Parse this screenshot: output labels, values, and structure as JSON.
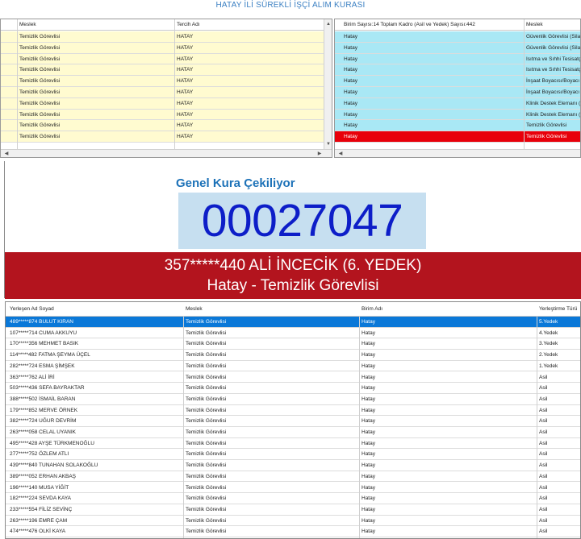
{
  "title": "HATAY İLİ SÜREKLİ İŞÇİ ALIM KURASI",
  "left_grid": {
    "columns": [
      "Meslek",
      "Tercih Adı"
    ],
    "rows": [
      {
        "meslek": "Temizlik Görevlisi",
        "tercih": "HATAY"
      },
      {
        "meslek": "Temizlik Görevlisi",
        "tercih": "HATAY"
      },
      {
        "meslek": "Temizlik Görevlisi",
        "tercih": "HATAY"
      },
      {
        "meslek": "Temizlik Görevlisi",
        "tercih": "HATAY"
      },
      {
        "meslek": "Temizlik Görevlisi",
        "tercih": "HATAY"
      },
      {
        "meslek": "Temizlik Görevlisi",
        "tercih": "HATAY"
      },
      {
        "meslek": "Temizlik Görevlisi",
        "tercih": "HATAY"
      },
      {
        "meslek": "Temizlik Görevlisi",
        "tercih": "HATAY"
      },
      {
        "meslek": "Temizlik Görevlisi",
        "tercih": "HATAY"
      },
      {
        "meslek": "Temizlik Görevlisi",
        "tercih": "HATAY"
      }
    ]
  },
  "right_grid": {
    "columns": [
      "Birim Sayısı:14 Toplam Kadro (Asil ve Yedek) Sayısı:442",
      "Meslek"
    ],
    "rows": [
      {
        "birim": "Hatay",
        "meslek": "Güvenlik Görevlisi (Silah"
      },
      {
        "birim": "Hatay",
        "meslek": "Güvenlik Görevlisi (Silah"
      },
      {
        "birim": "Hatay",
        "meslek": "Isıtma ve Sıhhi Tesisatçı"
      },
      {
        "birim": "Hatay",
        "meslek": "Isıtma ve Sıhhi Tesisatçı"
      },
      {
        "birim": "Hatay",
        "meslek": "İnşaat Boyacısı/Boyacı"
      },
      {
        "birim": "Hatay",
        "meslek": "İnşaat Boyacısı/Boyacı"
      },
      {
        "birim": "Hatay",
        "meslek": "Klinik Destek Elemanı (H"
      },
      {
        "birim": "Hatay",
        "meslek": "Klinik Destek Elemanı (H"
      },
      {
        "birim": "Hatay",
        "meslek": "Temizlik Görevlisi"
      },
      {
        "birim": "Hatay",
        "meslek": "Temizlik Görevlisi"
      }
    ],
    "selected_index": 9
  },
  "draw": {
    "heading": "Genel Kura Çekiliyor",
    "number": "00027047",
    "result_line1": "357*****440 ALİ İNCECİK (6. YEDEK)",
    "result_line2": "Hatay - Temizlik Görevlisi"
  },
  "bottom_grid": {
    "columns": [
      "Yerleşen Ad Soyad",
      "Meslek",
      "Birim Adı",
      "Yerleştirme Türü"
    ],
    "selected_index": 0,
    "rows": [
      {
        "name": "489*****874 BULUT KIRAN",
        "meslek": "Temizlik Görevlisi",
        "birim": "Hatay",
        "tur": "5.Yedek"
      },
      {
        "name": "107*****714 CUMA AKKUYU",
        "meslek": "Temizlik Görevlisi",
        "birim": "Hatay",
        "tur": "4.Yedek"
      },
      {
        "name": "170*****356 MEHMET BASIK",
        "meslek": "Temizlik Görevlisi",
        "birim": "Hatay",
        "tur": "3.Yedek"
      },
      {
        "name": "114*****482 FATMA ŞEYMA ÜÇEL",
        "meslek": "Temizlik Görevlisi",
        "birim": "Hatay",
        "tur": "2.Yedek"
      },
      {
        "name": "282*****724 ESMA ŞİMŞEK",
        "meslek": "Temizlik Görevlisi",
        "birim": "Hatay",
        "tur": "1.Yedek"
      },
      {
        "name": "363*****762 ALİ İRİ",
        "meslek": "Temizlik Görevlisi",
        "birim": "Hatay",
        "tur": "Asil"
      },
      {
        "name": "503*****436 SEFA BAYRAKTAR",
        "meslek": "Temizlik Görevlisi",
        "birim": "Hatay",
        "tur": "Asil"
      },
      {
        "name": "388*****502 İSMAİL BARAN",
        "meslek": "Temizlik Görevlisi",
        "birim": "Hatay",
        "tur": "Asil"
      },
      {
        "name": "179*****852 MERVE ÖRNEK",
        "meslek": "Temizlik Görevlisi",
        "birim": "Hatay",
        "tur": "Asil"
      },
      {
        "name": "382*****724 UĞUR DEVRİM",
        "meslek": "Temizlik Görevlisi",
        "birim": "Hatay",
        "tur": "Asil"
      },
      {
        "name": "263*****058 CELAL UYANIK",
        "meslek": "Temizlik Görevlisi",
        "birim": "Hatay",
        "tur": "Asil"
      },
      {
        "name": "495*****428 AYŞE TÜRKMENOĞLU",
        "meslek": "Temizlik Görevlisi",
        "birim": "Hatay",
        "tur": "Asil"
      },
      {
        "name": "277*****752 ÖZLEM ATLI",
        "meslek": "Temizlik Görevlisi",
        "birim": "Hatay",
        "tur": "Asil"
      },
      {
        "name": "439*****840 TUNAHAN SOLAKOĞLU",
        "meslek": "Temizlik Görevlisi",
        "birim": "Hatay",
        "tur": "Asil"
      },
      {
        "name": "389*****052 ERHAN AKBAŞ",
        "meslek": "Temizlik Görevlisi",
        "birim": "Hatay",
        "tur": "Asil"
      },
      {
        "name": "196*****140 MUSA YİĞİT",
        "meslek": "Temizlik Görevlisi",
        "birim": "Hatay",
        "tur": "Asil"
      },
      {
        "name": "182*****224 SEVDA KAYA",
        "meslek": "Temizlik Görevlisi",
        "birim": "Hatay",
        "tur": "Asil"
      },
      {
        "name": "233*****554 FİLİZ SEVİNÇ",
        "meslek": "Temizlik Görevlisi",
        "birim": "Hatay",
        "tur": "Asil"
      },
      {
        "name": "263*****196 EMRE ÇAM",
        "meslek": "Temizlik Görevlisi",
        "birim": "Hatay",
        "tur": "Asil"
      },
      {
        "name": "474*****476 OLKİ KAYA",
        "meslek": "Temizlik Görevlisi",
        "birim": "Hatay",
        "tur": "Asil"
      }
    ]
  },
  "colors": {
    "title": "#3a7fc2",
    "left_row_bg": "#fffbd0",
    "right_row_bg": "#a9e8f5",
    "right_selected_bg": "#e8000a",
    "banner_bg": "#b3141e",
    "number_color": "#0d1ec8",
    "number_box_bg": "#c6dff0",
    "bottom_selected_bg": "#0a78d8"
  },
  "icons": [
    "chevron-up-icon",
    "chevron-down-icon",
    "chevron-left-icon",
    "chevron-right-icon"
  ]
}
